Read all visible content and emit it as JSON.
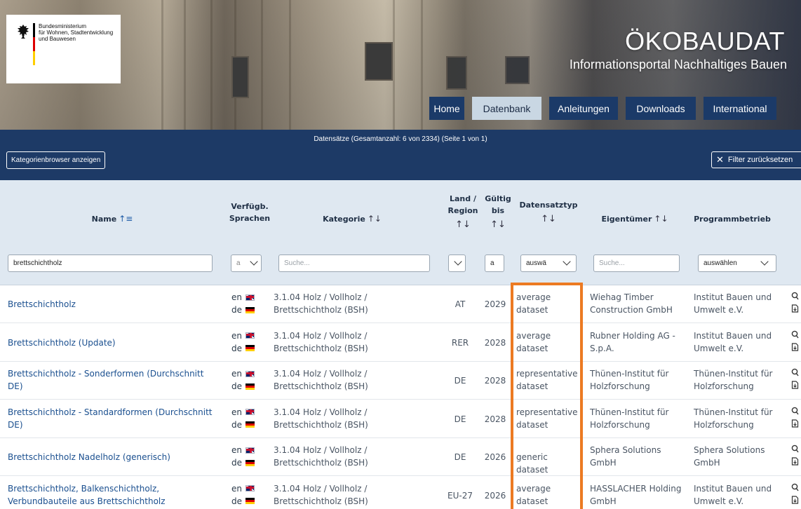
{
  "header": {
    "ministry_line1": "Bundesministerium",
    "ministry_line2": "für Wohnen, Stadtentwicklung",
    "ministry_line3": "und Bauwesen",
    "site_title": "ÖKOBAUDAT",
    "site_subtitle": "Informationsportal Nachhaltiges Bauen",
    "nav": [
      {
        "label": "Home",
        "active": false
      },
      {
        "label": "Datenbank",
        "active": true
      },
      {
        "label": "Anleitungen",
        "active": false
      },
      {
        "label": "Downloads",
        "active": false
      },
      {
        "label": "International",
        "active": false
      }
    ]
  },
  "toolbar": {
    "dataset_count": "Datensätze (Gesamtanzahl: 6 von 2334) (Seite 1 von 1)",
    "category_browser_label": "Kategorienbrowser anzeigen",
    "reset_filter_label": "Filter zurücksetzen"
  },
  "table": {
    "columns": {
      "name": "Name",
      "languages_1": "Verfügb.",
      "languages_2": "Sprachen",
      "category": "Kategorie",
      "land_1": "Land /",
      "land_2": "Region",
      "valid_1": "Gültig",
      "valid_2": "bis",
      "dtype": "Datensatztyp",
      "owner": "Eigentümer",
      "program": "Programmbetrieb"
    },
    "filters": {
      "name_value": "brettschichtholz",
      "lang_value": "a",
      "category_placeholder": "Suche...",
      "valid_value": "a",
      "dtype_value": "auswä",
      "owner_placeholder": "Suche...",
      "program_value": "auswählen"
    },
    "rows": [
      {
        "name": "Brettschichtholz",
        "lang1": "en",
        "lang2": "de",
        "cat1": "3.1.04 Holz / Vollholz /",
        "cat2": "Brettschichtholz (BSH)",
        "land": "AT",
        "valid": "2029",
        "dtype1": "average",
        "dtype2": "dataset",
        "owner1": "Wiehag Timber",
        "owner2": "Construction GmbH",
        "prog1": "Institut Bauen und",
        "prog2": "Umwelt e.V."
      },
      {
        "name": "Brettschichtholz (Update)",
        "lang1": "en",
        "lang2": "de",
        "cat1": "3.1.04 Holz / Vollholz /",
        "cat2": "Brettschichtholz (BSH)",
        "land": "RER",
        "valid": "2028",
        "dtype1": "average",
        "dtype2": "dataset",
        "owner1": "Rubner Holding AG -",
        "owner2": "S.p.A.",
        "prog1": "Institut Bauen und",
        "prog2": "Umwelt e.V."
      },
      {
        "name": "Brettschichtholz - Sonderformen (Durchschnitt DE)",
        "lang1": "en",
        "lang2": "de",
        "cat1": "3.1.04 Holz / Vollholz /",
        "cat2": "Brettschichtholz (BSH)",
        "land": "DE",
        "valid": "2028",
        "dtype1": "representative",
        "dtype2": "dataset",
        "owner1": "Thünen-Institut für",
        "owner2": "Holzforschung",
        "prog1": "Thünen-Institut für",
        "prog2": "Holzforschung"
      },
      {
        "name": "Brettschichtholz - Standardformen (Durchschnitt DE)",
        "lang1": "en",
        "lang2": "de",
        "cat1": "3.1.04 Holz / Vollholz /",
        "cat2": "Brettschichtholz (BSH)",
        "land": "DE",
        "valid": "2028",
        "dtype1": "representative",
        "dtype2": "dataset",
        "owner1": "Thünen-Institut für",
        "owner2": "Holzforschung",
        "prog1": "Thünen-Institut für",
        "prog2": "Holzforschung"
      },
      {
        "name": "Brettschichtholz Nadelholz (generisch)",
        "lang1": "en",
        "lang2": "de",
        "cat1": "3.1.04 Holz / Vollholz /",
        "cat2": "Brettschichtholz (BSH)",
        "land": "DE",
        "valid": "2026",
        "dtype1": "generic dataset",
        "dtype2": "",
        "owner1": "Sphera Solutions",
        "owner2": "GmbH",
        "prog1": "Sphera Solutions",
        "prog2": "GmbH"
      },
      {
        "name": "Brettschichtholz, Balkenschichtholz, Verbundbauteile aus Brettschichtholz",
        "lang1": "en",
        "lang2": "de",
        "cat1": "3.1.04 Holz / Vollholz /",
        "cat2": "Brettschichtholz (BSH)",
        "land": "EU-27",
        "valid": "2026",
        "dtype1": "average",
        "dtype2": "dataset",
        "owner1": "HASSLACHER Holding",
        "owner2": "GmbH",
        "prog1": "Institut Bauen und",
        "prog2": "Umwelt e.V."
      }
    ]
  },
  "colors": {
    "navy": "#1d3a66",
    "nav_active": "#c9d7e3",
    "header_row": "#dfe8f1",
    "link": "#1a4f8f",
    "highlight": "#ec7a22"
  },
  "icons": [
    "eagle-icon",
    "sort-ascending-icon",
    "sort-icon",
    "chevron-down-icon",
    "close-icon",
    "view-icon",
    "download-icon",
    "uk-flag-icon",
    "de-flag-icon"
  ]
}
